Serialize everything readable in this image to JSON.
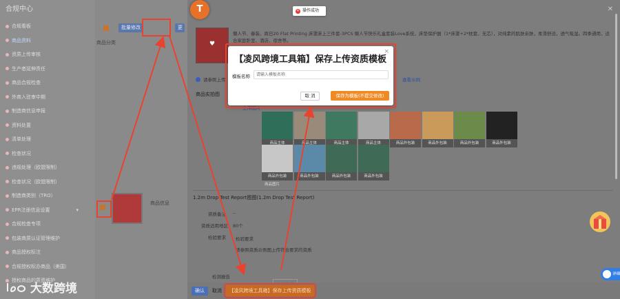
{
  "sidebar": {
    "title": "合规中心",
    "items": [
      {
        "label": "合规看板"
      },
      {
        "label": "商品资料",
        "active": true
      },
      {
        "label": "资质上传审核"
      },
      {
        "label": "生产者延伸责任"
      },
      {
        "label": "商品合规检查"
      },
      {
        "label": "外商入驻审中期"
      },
      {
        "label": "制造商信息申报"
      },
      {
        "label": "资料处置"
      },
      {
        "label": "清单处理"
      },
      {
        "label": "检查状况"
      },
      {
        "label": "违规处理（欧盟限制）"
      },
      {
        "label": "检查状况（欧盟限制）"
      },
      {
        "label": "制造商类别（TRO）"
      },
      {
        "label": "EPR注册信息设置",
        "caret": "▾"
      },
      {
        "label": "合规检查专项"
      },
      {
        "label": "包装商质认证管理维护"
      },
      {
        "label": "商品授权标注"
      },
      {
        "label": "合规授权标办商品（美国）"
      },
      {
        "label": "授权商品的质资维护"
      }
    ]
  },
  "main": {
    "batch_button": "批量修改",
    "category_tag": "商品分类",
    "more_button": "更多",
    "product_label": "商品信息"
  },
  "drawer": {
    "orange_badge": "T",
    "product_description": "懒人节、春装、周日20 Flat Printing 床罩床上三件套-3PCS 懒人节快乐礼盒套装Love系统，床垫保护器（1*床罩+2*枕套，无芯），对纯素的肌肤亲肤，柔滑舒适，透气吸湿。四季通用，适合家庭卧室、酒店、宿舍等。",
    "radio_label": "请参照上传",
    "link_text": "查看示例",
    "gallery_label": "商品实拍图",
    "gallery_link": "上传图片",
    "images": [
      {
        "caption": "商品主体"
      },
      {
        "caption": "商品主体"
      },
      {
        "caption": "商品主体"
      },
      {
        "caption": "商品主体"
      },
      {
        "caption": "商品外包装"
      },
      {
        "caption": "商品外包装"
      },
      {
        "caption": "商品外包装"
      },
      {
        "caption": "商品外包装"
      },
      {
        "caption": "商品外包装"
      },
      {
        "caption": "商品外包装"
      },
      {
        "caption": "商品外包装"
      },
      {
        "caption": "商品外包装"
      }
    ],
    "extra_caption": "商品图片",
    "report_section": "1.2m Drop Test Report图图(1.2m Drop Test Report)",
    "kv": [
      {
        "k": "资质备注",
        "v": "--"
      },
      {
        "k": "资质适用地区",
        "v": "80个"
      },
      {
        "k": "检验要求",
        "v": "检验要求"
      },
      {
        "k": "",
        "v": "请参照资质示例图上传符合要求的资质"
      },
      {
        "k": "检测报告",
        "v": "上传文件"
      }
    ],
    "confirm_button": "确认",
    "cancel_button": "取消",
    "save_template_button": "【凌风跨境工具箱】保存上传资质模板"
  },
  "toast": {
    "text": "操作成功",
    "icon": "error-icon"
  },
  "modal": {
    "title": "【凌风跨境工具箱】保存上传资质模板",
    "label": "模板名称",
    "input_placeholder": "请输入模板名称",
    "cancel": "取 消",
    "save": "保存为模板(不提交修改)"
  },
  "watermark": {
    "text": "大数跨境"
  },
  "toggle": {
    "label": "详细"
  },
  "colors": {
    "accent": "#f08a24",
    "highlight_red": "#e8432e",
    "primary_blue": "#4b6fb5"
  }
}
